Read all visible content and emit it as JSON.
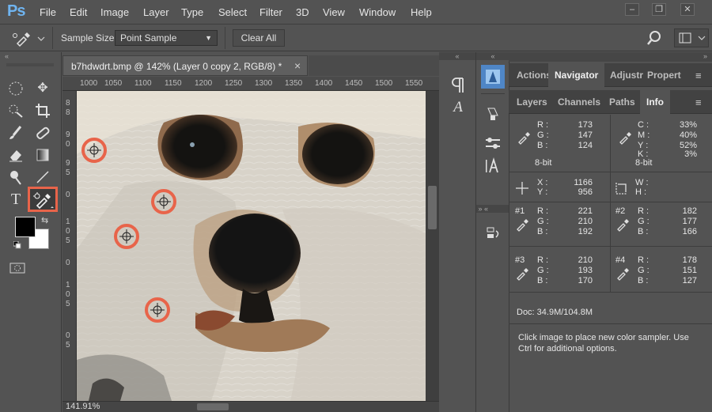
{
  "menubar": {
    "logo": "Ps",
    "items": [
      "File",
      "Edit",
      "Image",
      "Layer",
      "Type",
      "Select",
      "Filter",
      "3D",
      "View",
      "Window",
      "Help"
    ]
  },
  "options": {
    "sample_size_label": "Sample Size:",
    "sample_size_value": "Point Sample",
    "clear_all_label": "Clear All"
  },
  "document": {
    "tab_title": "b7hdwdrt.bmp @ 142% (Layer 0 copy 2, RGB/8) *",
    "tab_close": "×",
    "ruler_h_ticks": [
      "1000",
      "1050",
      "1100",
      "1150",
      "1200",
      "1250",
      "1300",
      "1350",
      "1400",
      "1450",
      "1500",
      "1550"
    ],
    "ruler_v_ticks": [
      "8",
      "8",
      "9",
      "0",
      "9",
      "5",
      "0",
      "1",
      "0",
      "5",
      "0",
      "1",
      "0",
      "5",
      "0",
      "5"
    ],
    "zoom": "141.91%"
  },
  "panel_top": {
    "tabs": [
      "Actions",
      "Navigator",
      "Adjustr",
      "Propert"
    ],
    "active": "Navigator"
  },
  "panel_info_tabs": {
    "tabs": [
      "Layers",
      "Channels",
      "Paths",
      "Info"
    ],
    "active": "Info"
  },
  "info": {
    "rgb": {
      "r": "173",
      "g": "147",
      "b": "124",
      "r_label": "R :",
      "g_label": "G :",
      "b_label": "B :"
    },
    "cmyk": {
      "c": "33%",
      "m": "40%",
      "y": "52%",
      "k": "3%",
      "c_label": "C :",
      "m_label": "M :",
      "y_label": "Y :",
      "k_label": "K :"
    },
    "bitdepth_left": "8-bit",
    "bitdepth_right": "8-bit",
    "xy": {
      "x": "1166",
      "y": "956",
      "x_label": "X :",
      "y_label": "Y :"
    },
    "wh": {
      "w_label": "W :",
      "h_label": "H :"
    },
    "samplers": [
      {
        "num": "#1",
        "r": "221",
        "g": "210",
        "b": "192"
      },
      {
        "num": "#2",
        "r": "182",
        "g": "177",
        "b": "166"
      },
      {
        "num": "#3",
        "r": "210",
        "g": "193",
        "b": "170"
      },
      {
        "num": "#4",
        "r": "178",
        "g": "151",
        "b": "127"
      }
    ],
    "r_label": "R :",
    "g_label": "G :",
    "b_label": "B :",
    "doc": "Doc: 34.9M/104.8M",
    "hint": "Click image to place new color sampler.  Use Ctrl for additional options."
  },
  "colors": {
    "highlight": "#e8644a",
    "accent": "#6fb4f0"
  }
}
